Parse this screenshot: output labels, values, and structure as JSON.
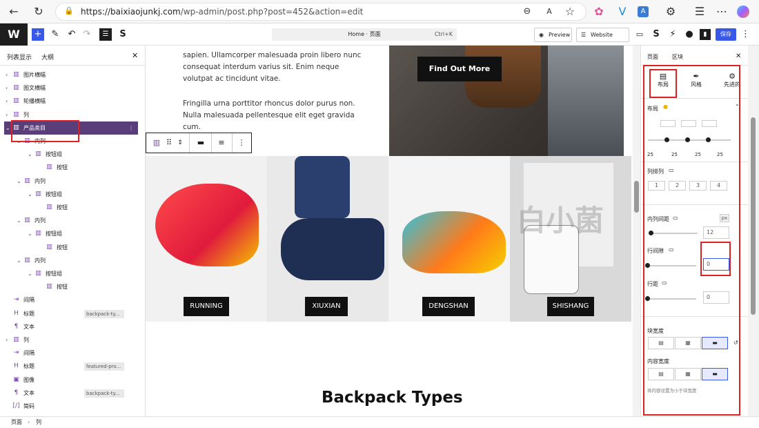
{
  "browser": {
    "url_host": "https://baixiaojunkj.com",
    "url_path": "/wp-admin/post.php?post=452&action=edit"
  },
  "toolbar": {
    "command_label": "Home · 页面",
    "command_shortcut": "Ctrl+K",
    "preview": "Preview",
    "website_setup": "Website setup",
    "save": "保存"
  },
  "left_panel": {
    "tab_list": "列表显示",
    "tab_outline": "大纲",
    "items": [
      {
        "label": "图片横幅",
        "indent": 0,
        "chev": "›",
        "tag": ""
      },
      {
        "label": "图文横幅",
        "indent": 0,
        "chev": "›",
        "tag": ""
      },
      {
        "label": "轮播横幅",
        "indent": 0,
        "chev": "›",
        "tag": ""
      },
      {
        "label": "列",
        "indent": 0,
        "chev": "›",
        "tag": ""
      },
      {
        "label": "产品类目",
        "indent": 0,
        "chev": "⌄",
        "tag": "",
        "selected": true
      },
      {
        "label": "内列",
        "indent": 1,
        "chev": "⌄",
        "tag": ""
      },
      {
        "label": "按钮组",
        "indent": 2,
        "chev": "⌄",
        "tag": ""
      },
      {
        "label": "按钮",
        "indent": 3,
        "chev": "",
        "tag": ""
      },
      {
        "label": "内列",
        "indent": 1,
        "chev": "⌄",
        "tag": ""
      },
      {
        "label": "按钮组",
        "indent": 2,
        "chev": "⌄",
        "tag": ""
      },
      {
        "label": "按钮",
        "indent": 3,
        "chev": "",
        "tag": ""
      },
      {
        "label": "内列",
        "indent": 1,
        "chev": "⌄",
        "tag": ""
      },
      {
        "label": "按钮组",
        "indent": 2,
        "chev": "⌄",
        "tag": ""
      },
      {
        "label": "按钮",
        "indent": 3,
        "chev": "",
        "tag": ""
      },
      {
        "label": "内列",
        "indent": 1,
        "chev": "⌄",
        "tag": ""
      },
      {
        "label": "按钮组",
        "indent": 2,
        "chev": "⌄",
        "tag": ""
      },
      {
        "label": "按钮",
        "indent": 3,
        "chev": "",
        "tag": ""
      },
      {
        "label": "间隔",
        "indent": 0,
        "chev": "",
        "tag": ""
      },
      {
        "label": "标题",
        "indent": 0,
        "chev": "",
        "tag": "backpack-ty..."
      },
      {
        "label": "文本",
        "indent": 0,
        "chev": "",
        "tag": ""
      },
      {
        "label": "列",
        "indent": 0,
        "chev": "›",
        "tag": ""
      },
      {
        "label": "间隔",
        "indent": 0,
        "chev": "",
        "tag": ""
      },
      {
        "label": "标题",
        "indent": 0,
        "chev": "",
        "tag": "featured-pro..."
      },
      {
        "label": "图像",
        "indent": 0,
        "chev": "",
        "tag": ""
      },
      {
        "label": "文本",
        "indent": 0,
        "chev": "",
        "tag": "backpack-ty..."
      },
      {
        "label": "简码",
        "indent": 0,
        "chev": "",
        "tag": ""
      }
    ]
  },
  "canvas": {
    "para1": "sapien. Ullamcorper malesuada proin libero nunc consequat interdum varius sit. Enim neque volutpat ac tincidunt vitae.",
    "para2": "Fringilla urna porttitor rhoncus dolor purus non. Nulla malesuada pellentesque elit eget gravida cum.",
    "find_more": "Find Out More",
    "shoes": [
      "RUNNING",
      "XIUXIAN",
      "DENGSHAN",
      "SHISHANG"
    ],
    "section_title": "Backpack Types",
    "watermark": "白小菌"
  },
  "right_panel": {
    "tab_page": "页面",
    "tab_block": "区块",
    "sub_layout": "布局",
    "sub_style": "风格",
    "sub_advanced": "先进的",
    "layout_heading": "布局",
    "col_values": [
      "25",
      "25",
      "25",
      "25"
    ],
    "col_arrange": "列排列",
    "arrange_opts": [
      "1",
      "2",
      "3",
      "4"
    ],
    "inner_gap": "内列间距",
    "unit": "px",
    "inner_gap_value": "12",
    "col_gap": "行间隙",
    "col_gap_value": "0",
    "row_gap": "行距",
    "row_gap_value": "0",
    "block_width": "块宽度",
    "content_width": "内容宽度",
    "hint": "将内容设置为小于块宽度"
  },
  "status": {
    "crumb1": "页面",
    "crumb2": "列"
  },
  "colors": {
    "accent": "#3858e9",
    "selected": "#5a3e7a",
    "highlight": "#e02020"
  }
}
